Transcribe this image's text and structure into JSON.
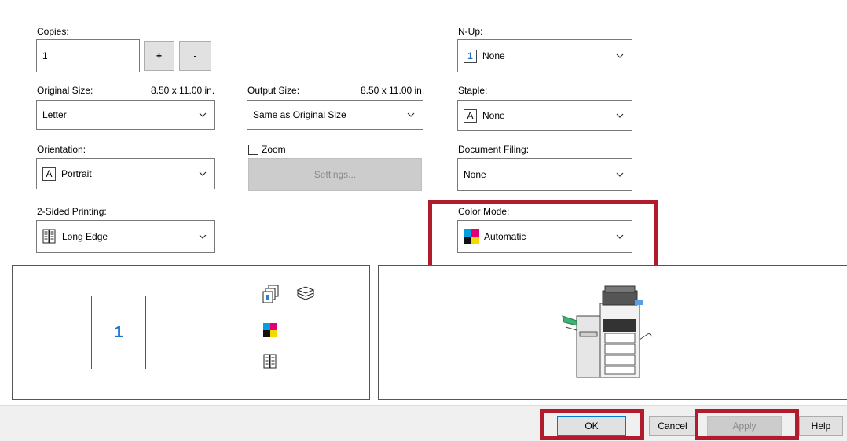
{
  "copies": {
    "label": "Copies:",
    "value": "1",
    "plus_label": "+",
    "minus_label": "-"
  },
  "original_size": {
    "label": "Original Size:",
    "dimensions": "8.50 x 11.00 in.",
    "value": "Letter"
  },
  "output_size": {
    "label": "Output Size:",
    "dimensions": "8.50 x 11.00 in.",
    "value": "Same as Original Size"
  },
  "orientation": {
    "label": "Orientation:",
    "icon_glyph": "A",
    "value": "Portrait"
  },
  "zoom": {
    "label": "Zoom",
    "checked": false,
    "settings_label": "Settings..."
  },
  "two_sided": {
    "label": "2-Sided Printing:",
    "value": "Long Edge"
  },
  "n_up": {
    "label": "N-Up:",
    "icon_glyph": "1",
    "value": "None"
  },
  "staple": {
    "label": "Staple:",
    "icon_glyph": "A",
    "value": "None"
  },
  "document_filing": {
    "label": "Document Filing:",
    "value": "None"
  },
  "color_mode": {
    "label": "Color Mode:",
    "value": "Automatic"
  },
  "preview": {
    "page_number": "1"
  },
  "buttons": {
    "ok": "OK",
    "cancel": "Cancel",
    "apply": "Apply",
    "help": "Help"
  },
  "colors": {
    "highlight": "#b01c2e",
    "page_number": "#1a73c8",
    "disabled_button": "#cccccc"
  }
}
